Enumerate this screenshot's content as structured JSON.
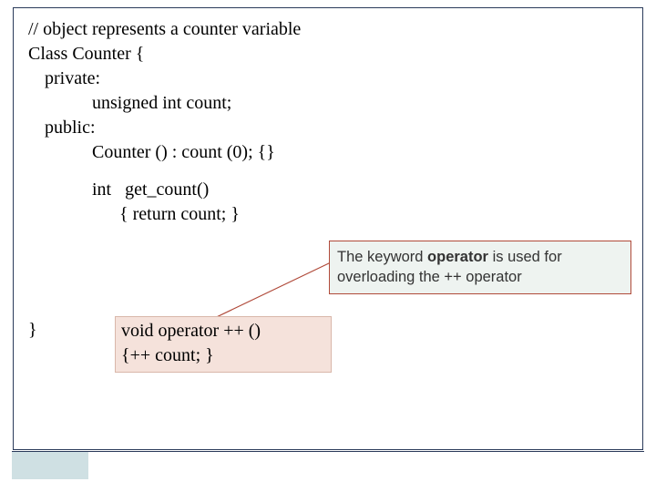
{
  "code": {
    "l1": "// object represents a counter variable",
    "l2": "Class Counter {",
    "l3": "private:",
    "l4": "unsigned int count;",
    "l5": "public:",
    "l6": "Counter () : count (0); {}",
    "l7": "int   get_count()",
    "l8": "{ return count; }",
    "hl1": "void operator ++ ()",
    "hl2": "{++ count; }",
    "l9": "}"
  },
  "callout": {
    "pre": "The keyword ",
    "kw": "operator",
    "post": "  is used for overloading the ++ operator"
  }
}
